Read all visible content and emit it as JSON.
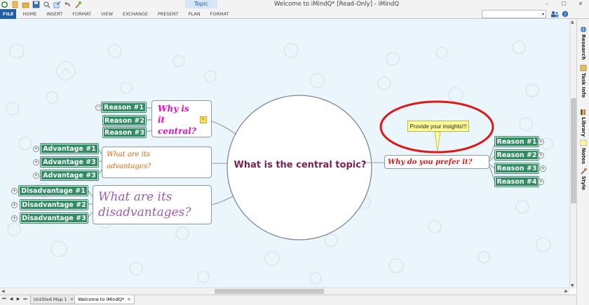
{
  "window": {
    "title": "Welcome to iMindQ* [Read-Only] - iMindQ",
    "context_tab": "Topic",
    "controls": [
      "–",
      "☐",
      "✕"
    ]
  },
  "quick_access": [
    "↻",
    "◆",
    "▬",
    "▣",
    "⌕",
    "↗",
    "↩",
    "★"
  ],
  "ribbon": {
    "tabs": [
      "FILE",
      "HOME",
      "INSERT",
      "FORMAT",
      "VIEW",
      "EXCHANGE",
      "PRESENT",
      "PLAN",
      "FORMAT"
    ],
    "search_placeholder": "",
    "dropdown_arrow": "▾"
  },
  "side_panel": {
    "items": [
      {
        "label": "Research",
        "icon": "globe-icon"
      },
      {
        "label": "Task Info",
        "icon": "task-icon"
      },
      {
        "label": "Library",
        "icon": "library-icon"
      },
      {
        "label": "Notes",
        "icon": "notes-icon"
      },
      {
        "label": "Style",
        "icon": "style-icon"
      }
    ]
  },
  "map": {
    "central": "What is the central topic?",
    "why": {
      "text": "Why is it central?",
      "line1": "Why is",
      "line2": "it",
      "line3": "central?",
      "reasons": [
        "Reason #1",
        "Reason #2",
        "Reason #3"
      ]
    },
    "advantages": {
      "line1": "What are its",
      "line2": "advantages?",
      "items": [
        "Advantage #1",
        "Advantage #3",
        "Advantage #3"
      ]
    },
    "disadvantages": {
      "line1": "What are its",
      "line2": "disadvantages?",
      "items": [
        "Disadvantage #1",
        "Disadvantage #2",
        "Disadvantage #3"
      ]
    },
    "prefer": {
      "text": "Why do you prefer it?",
      "callout": "Provide your insights!!!",
      "reasons": [
        "Reason #1",
        "Reason #2",
        "Reason #3",
        "Reason #4"
      ]
    },
    "expand_symbol": "+",
    "collapse_symbol": "−",
    "highlight_color": "#e01717"
  },
  "sheets": {
    "nav": [
      "⏮",
      "◀",
      "▶",
      "⏭"
    ],
    "tabs": [
      {
        "label": "Untitled Map 1",
        "active": false
      },
      {
        "label": "Welcome to iMindQ*",
        "active": true
      }
    ],
    "close": "✕"
  }
}
